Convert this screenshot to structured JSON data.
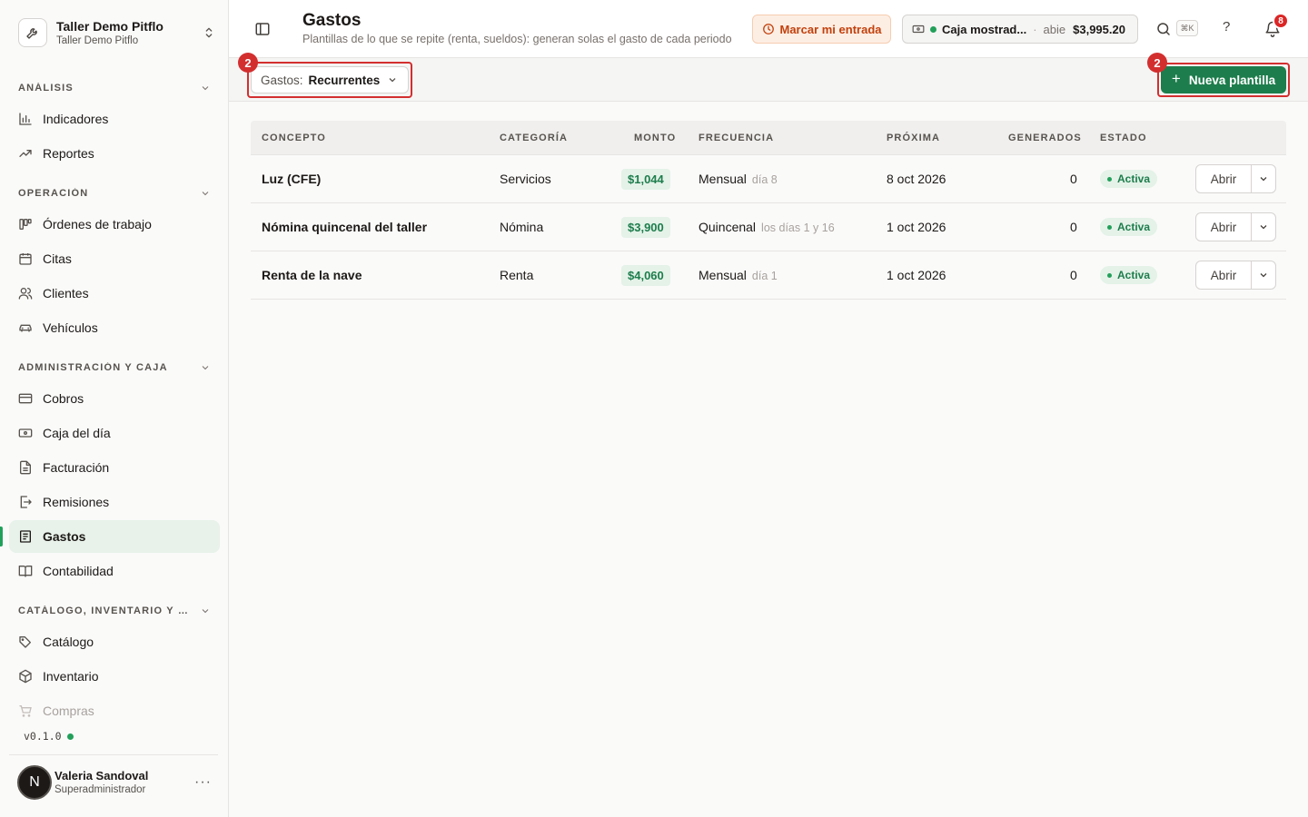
{
  "org": {
    "name": "Taller Demo Pitflo",
    "subtitle": "Taller Demo Pitflo"
  },
  "sidebar": {
    "sections": [
      {
        "title": "ANÁLISIS",
        "items": [
          "Indicadores",
          "Reportes"
        ]
      },
      {
        "title": "OPERACIÓN",
        "items": [
          "Órdenes de trabajo",
          "Citas",
          "Clientes",
          "Vehículos"
        ]
      },
      {
        "title": "ADMINISTRACIÓN Y CAJA",
        "items": [
          "Cobros",
          "Caja del día",
          "Facturación",
          "Remisiones",
          "Gastos",
          "Contabilidad"
        ]
      },
      {
        "title": "CATÁLOGO, INVENTARIO Y COMPRAS",
        "items": [
          "Catálogo",
          "Inventario",
          "Compras"
        ]
      }
    ],
    "active_item": "Gastos",
    "version": "v0.1.0"
  },
  "user": {
    "initial": "N",
    "name": "Valeria Sandoval",
    "role": "Superadministrador",
    "more": "···"
  },
  "header": {
    "title": "Gastos",
    "subtitle": "Plantillas de lo que se repite (renta, sueldos): generan solas el gasto de cada periodo",
    "clock_in_label": "Marcar mi entrada",
    "cash": {
      "name": "Caja mostrad...",
      "separator": "·",
      "status": "abie",
      "amount": "$3,995.20"
    },
    "search_shortcut": "⌘K",
    "help": "?",
    "notifications_count": "8"
  },
  "filterbar": {
    "filter_label": "Gastos:",
    "filter_value": "Recurrentes",
    "new_button": "Nueva plantilla",
    "new_button_icon": "+",
    "highlight_badges": [
      "2",
      "2"
    ]
  },
  "table": {
    "headers": [
      "CONCEPTO",
      "CATEGORÍA",
      "MONTO",
      "FRECUENCIA",
      "PRÓXIMA",
      "GENERADOS",
      "ESTADO"
    ],
    "rows": [
      {
        "concept": "Luz (CFE)",
        "category": "Servicios",
        "amount": "$1,044",
        "frequency": "Mensual",
        "frequency_detail": "día 8",
        "next": "8 oct 2026",
        "generated": "0",
        "status": "Activa",
        "action": "Abrir"
      },
      {
        "concept": "Nómina quincenal del taller",
        "category": "Nómina",
        "amount": "$3,900",
        "frequency": "Quincenal",
        "frequency_detail": "los días 1 y 16",
        "next": "1 oct 2026",
        "generated": "0",
        "status": "Activa",
        "action": "Abrir"
      },
      {
        "concept": "Renta de la nave",
        "category": "Renta",
        "amount": "$4,060",
        "frequency": "Mensual",
        "frequency_detail": "día 1",
        "next": "1 oct 2026",
        "generated": "0",
        "status": "Activa",
        "action": "Abrir"
      }
    ]
  },
  "colors": {
    "accent": "#1d7d4c",
    "warning": "#c2410c",
    "highlight": "#d32f2f",
    "badge": "#dc2626"
  }
}
